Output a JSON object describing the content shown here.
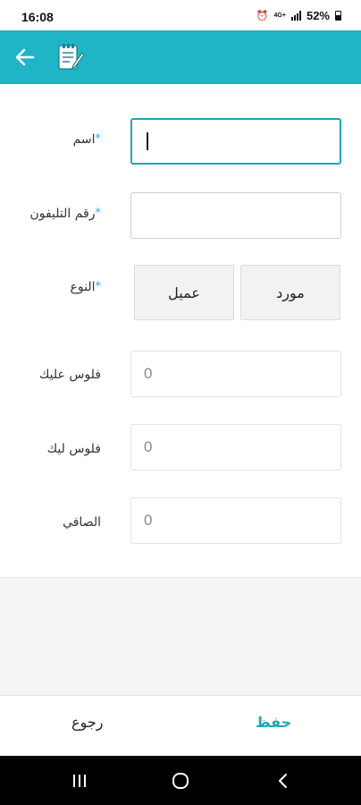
{
  "status_bar": {
    "time": "16:08",
    "battery": "52%",
    "network": "4G+",
    "icons": [
      "alarm-icon",
      "network-icon",
      "signal-icon",
      "battery-icon"
    ]
  },
  "toolbar": {
    "background": "#1fb5c6",
    "icons": [
      "back-arrow-icon",
      "note-icon"
    ]
  },
  "form": {
    "accent": "#1fb5c6",
    "required_mark": "*",
    "name": {
      "label": "اسم",
      "required": true,
      "value": ""
    },
    "phone": {
      "label": "رقم التليفون",
      "required": true,
      "value": ""
    },
    "type": {
      "label": "النوع",
      "required": true,
      "options": [
        "مورد",
        "عميل"
      ]
    },
    "owed_by_you": {
      "label": "فلوس عليك",
      "value": "0"
    },
    "owed_to_you": {
      "label": "فلوس ليك",
      "value": "0"
    },
    "net": {
      "label": "الصافي",
      "value": "0"
    }
  },
  "actions": {
    "back_label": "رجوع",
    "save_label": "حفظ"
  },
  "nav": {
    "icons": [
      "recent-apps-icon",
      "home-icon",
      "back-icon"
    ]
  }
}
